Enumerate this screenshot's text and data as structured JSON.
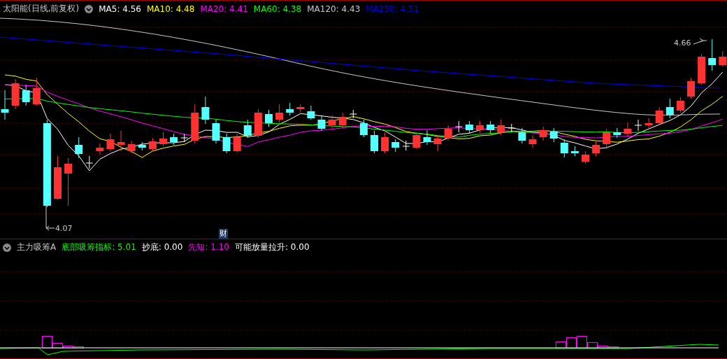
{
  "price_panel": {
    "title": "太阳能(日线,前复权)",
    "ma_lines": [
      {
        "label": "MA5:",
        "value": "4.56",
        "color": "#ffffff"
      },
      {
        "label": "MA10:",
        "value": "4.48",
        "color": "#ffff00"
      },
      {
        "label": "MA20:",
        "value": "4.41",
        "color": "#ff00ff"
      },
      {
        "label": "MA60:",
        "value": "4.38",
        "color": "#00ff00"
      },
      {
        "label": "MA120:",
        "value": "4.43",
        "color": "#c8c8c8"
      },
      {
        "label": "MA250:",
        "value": "4.51",
        "color": "#0000ff"
      }
    ],
    "high_label": "4.66",
    "low_label": "4.07",
    "badge": "财"
  },
  "indicator_panel": {
    "title": "主力吸筹A",
    "items": [
      {
        "label": "底部吸筹指标:",
        "value": "5.01",
        "color": "#00ff00"
      },
      {
        "label": "抄底:",
        "value": "0.00",
        "color": "#ffffff"
      },
      {
        "label": "先知:",
        "value": "1.10",
        "color": "#ff00ff"
      },
      {
        "label": "可能放量拉升:",
        "value": "0.00",
        "color": "#ffffff"
      }
    ]
  }
}
